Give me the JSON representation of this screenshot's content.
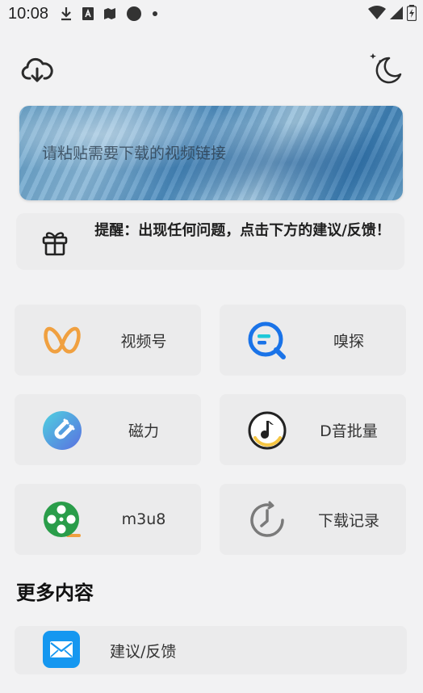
{
  "status_bar": {
    "time": "10:08",
    "icons": [
      "download-icon",
      "a-icon",
      "book-icon",
      "circle-icon",
      "dot-icon"
    ],
    "right_icons": [
      "wifi-icon",
      "signal-icon",
      "battery-icon"
    ]
  },
  "toolbar": {
    "download_icon": "cloud-download-icon",
    "theme_icon": "night-mode-icon"
  },
  "banner": {
    "placeholder": "请粘贴需要下载的视频链接",
    "value": ""
  },
  "notice": {
    "text": "提醒：出现任何问题，点击下方的建议/反馈！"
  },
  "tools": [
    {
      "label": "视频号",
      "icon": "wechat-channels-icon",
      "color": "#f0a040"
    },
    {
      "label": "嗅探",
      "icon": "sniff-search-icon",
      "color": "#1a73e8"
    },
    {
      "label": "磁力",
      "icon": "magnet-icon",
      "color": "#4a8fd8"
    },
    {
      "label": "D音批量",
      "icon": "music-note-icon",
      "color": "#f5c542"
    },
    {
      "label": "m3u8",
      "icon": "film-reel-icon",
      "color": "#2a9d4a"
    },
    {
      "label": "下载记录",
      "icon": "history-clock-icon",
      "color": "#7a7a7a"
    }
  ],
  "more": {
    "title": "更多内容",
    "items": [
      {
        "label": "建议/反馈",
        "icon": "mail-icon",
        "color": "#1597f0"
      }
    ]
  }
}
